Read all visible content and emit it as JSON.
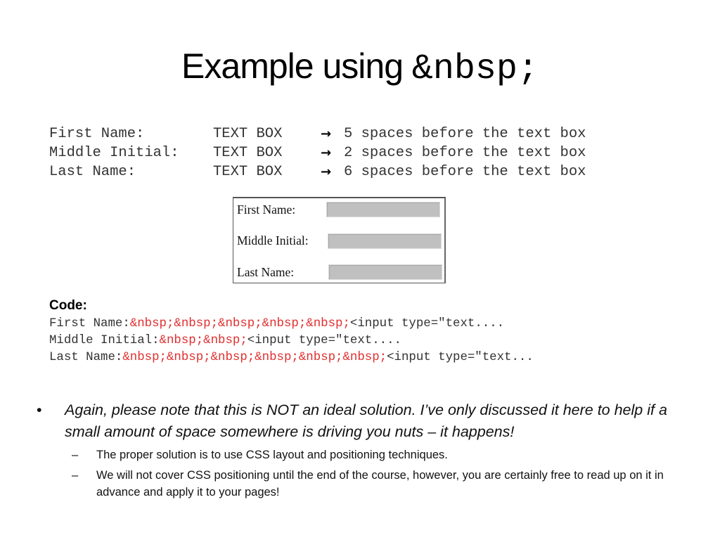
{
  "slide": {
    "title_text": "Example using ",
    "title_code": "&nbsp;"
  },
  "spec": {
    "rows": [
      {
        "label": "First Name:",
        "box": "TEXT BOX",
        "arrow": "→",
        "desc": "5 spaces before the text box"
      },
      {
        "label": "Middle Initial:",
        "box": "TEXT BOX",
        "arrow": "→",
        "desc": "2 spaces before the text box"
      },
      {
        "label": "Last Name:",
        "box": "TEXT BOX",
        "arrow": "→",
        "desc": "6 spaces before the text box"
      }
    ]
  },
  "form_demo": {
    "fields": [
      {
        "label": "First Name:",
        "value": ""
      },
      {
        "label": "Middle Initial:",
        "value": ""
      },
      {
        "label": "Last Name:",
        "value": ""
      }
    ]
  },
  "code": {
    "heading": "Code:",
    "lines": [
      {
        "prefix": "First Name:",
        "entities": "&nbsp;&nbsp;&nbsp;&nbsp;&nbsp;",
        "suffix": "<input type=\"text...."
      },
      {
        "prefix": "Middle Initial:",
        "entities": "&nbsp;&nbsp;",
        "suffix": "<input type=\"text...."
      },
      {
        "prefix": "Last Name:",
        "entities": "&nbsp;&nbsp;&nbsp;&nbsp;&nbsp;&nbsp;",
        "suffix": "<input type=\"text..."
      }
    ],
    "entity_color": "#e03030"
  },
  "notes": {
    "bullet_symbol": "•",
    "main": "Again, please note that this is NOT an ideal solution. I’ve only discussed it here to help if a small amount of space somewhere is driving you nuts – it happens!",
    "dash_symbol": "–",
    "subs": [
      "The proper solution is to use CSS layout and positioning techniques.",
      "We will not cover CSS positioning until the end of the course, however, you are certainly free to read up on it in advance and apply it to your pages!"
    ]
  }
}
